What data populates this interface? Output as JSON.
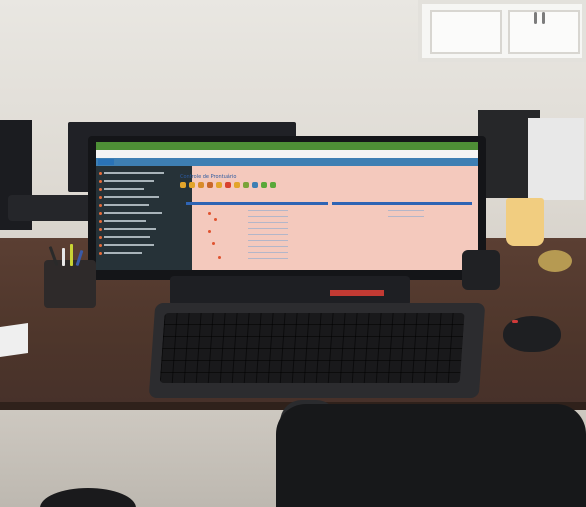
{
  "photo": {
    "subject": "",
    "palette": {
      "wall": "#e3e0da",
      "desk": "#523a2f",
      "screen_bg": "#f4c9bd",
      "app_header": "#3e7fb3",
      "sidebar": "#263238",
      "browser_tabs": "#4e8f36",
      "cup": "#f1cd80",
      "stand_accent": "#c23a33"
    },
    "icons": {
      "sidebar_marker": "dot-icon"
    }
  },
  "screen": {
    "page_title": "Controle de Prontuário"
  }
}
